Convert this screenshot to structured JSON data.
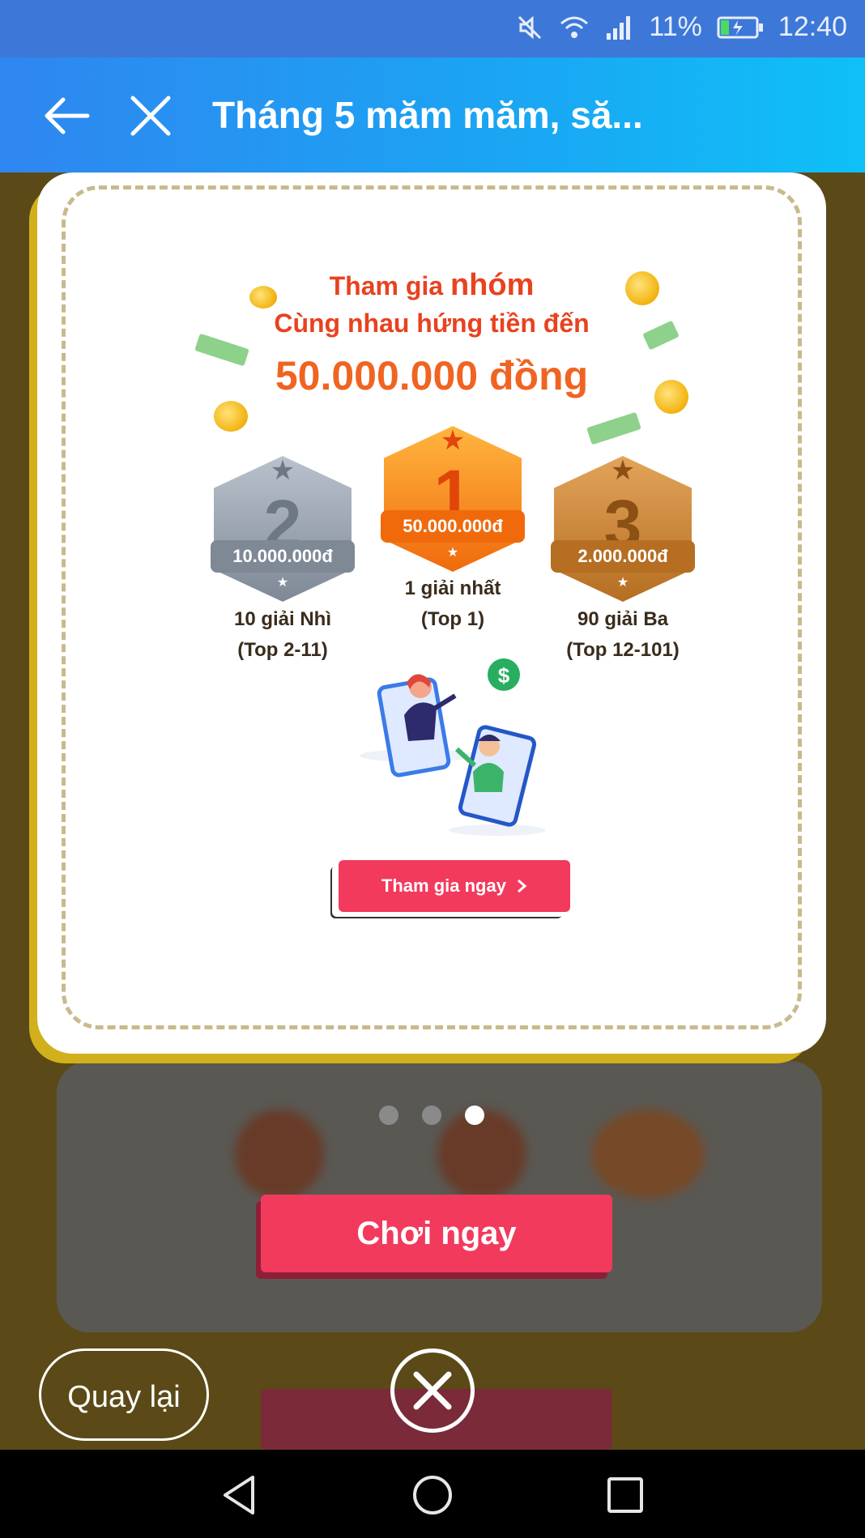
{
  "status_bar": {
    "battery_percent": "11%",
    "time": "12:40"
  },
  "app_bar": {
    "title": "Tháng 5 măm măm, să..."
  },
  "promo": {
    "line1_prefix": "Tham gia ",
    "line1_highlight": "nhóm",
    "line2": "Cùng nhau hứng tiền đến",
    "amount": "50.000.000 đồng",
    "prizes": [
      {
        "rank": "2",
        "amount": "10.000.000đ",
        "label_line1": "10 giải Nhì",
        "label_line2": "(Top 2-11)",
        "color": "#8b96a3"
      },
      {
        "rank": "1",
        "amount": "50.000.000đ",
        "label_line1": "1 giải nhất",
        "label_line2": "(Top 1)",
        "color": "#f47a16"
      },
      {
        "rank": "3",
        "amount": "2.000.000đ",
        "label_line1": "90 giải Ba",
        "label_line2": "(Top 12-101)",
        "color": "#c9832f"
      }
    ],
    "join_button": "Tham gia ngay"
  },
  "carousel": {
    "page_count": 3,
    "active_index": 2
  },
  "play_button": "Chơi ngay",
  "back_button": "Quay lại",
  "colors": {
    "accent": "#f23a5d",
    "header_blue": "#2f86f0",
    "card_border": "#d2b01c"
  },
  "icons": [
    "mute-icon",
    "wifi-icon",
    "signal-icon",
    "battery-icon",
    "back-arrow-icon",
    "close-icon",
    "chevron-right-icon",
    "close-circle-icon",
    "nav-back-icon",
    "nav-home-icon",
    "nav-recents-icon"
  ]
}
